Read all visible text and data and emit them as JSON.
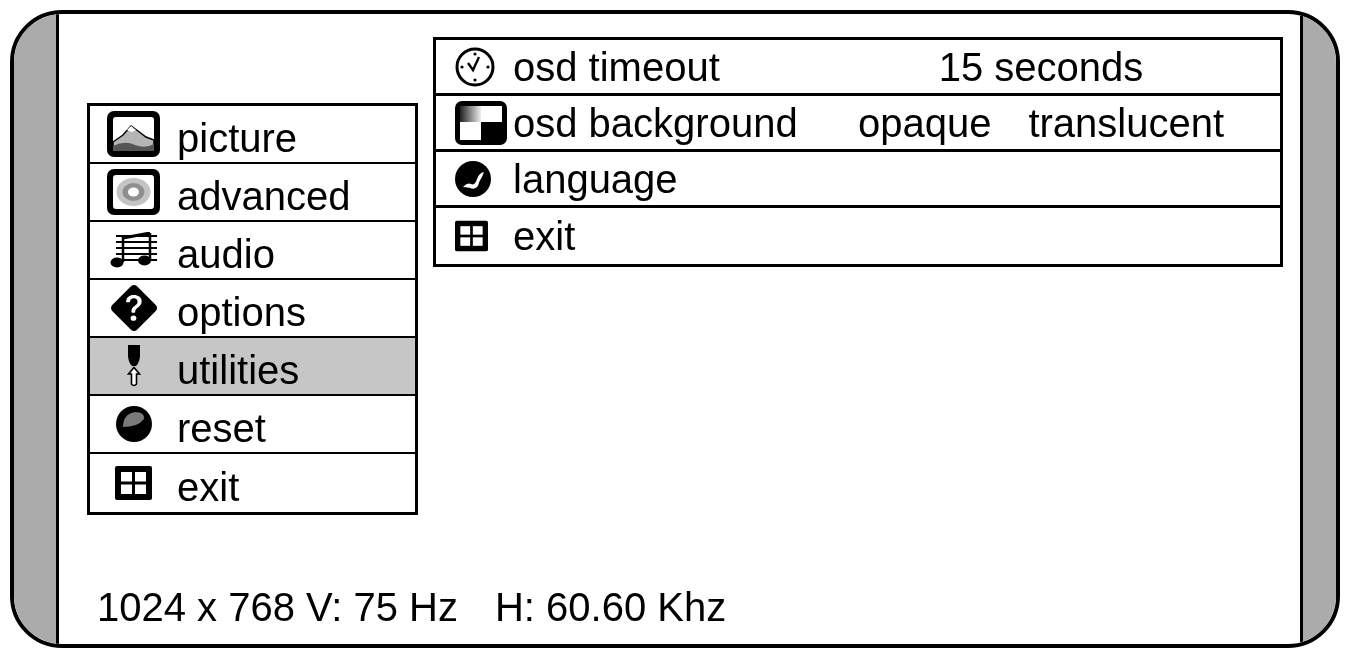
{
  "main_menu": {
    "items": [
      {
        "label": "picture",
        "selected": false
      },
      {
        "label": "advanced",
        "selected": false
      },
      {
        "label": "audio",
        "selected": false
      },
      {
        "label": "options",
        "selected": false
      },
      {
        "label": "utilities",
        "selected": true
      },
      {
        "label": "reset",
        "selected": false
      },
      {
        "label": "exit",
        "selected": false
      }
    ]
  },
  "submenu": {
    "rows": [
      {
        "label": "osd timeout",
        "values": [
          "15 seconds"
        ]
      },
      {
        "label": "osd background",
        "values": [
          "opaque",
          "translucent"
        ]
      },
      {
        "label": "language"
      },
      {
        "label": "exit"
      }
    ]
  },
  "status_bar": {
    "mode": "1024 x 768 V: 75 Hz",
    "horizontal_frequency": "H: 60.60 Khz"
  }
}
